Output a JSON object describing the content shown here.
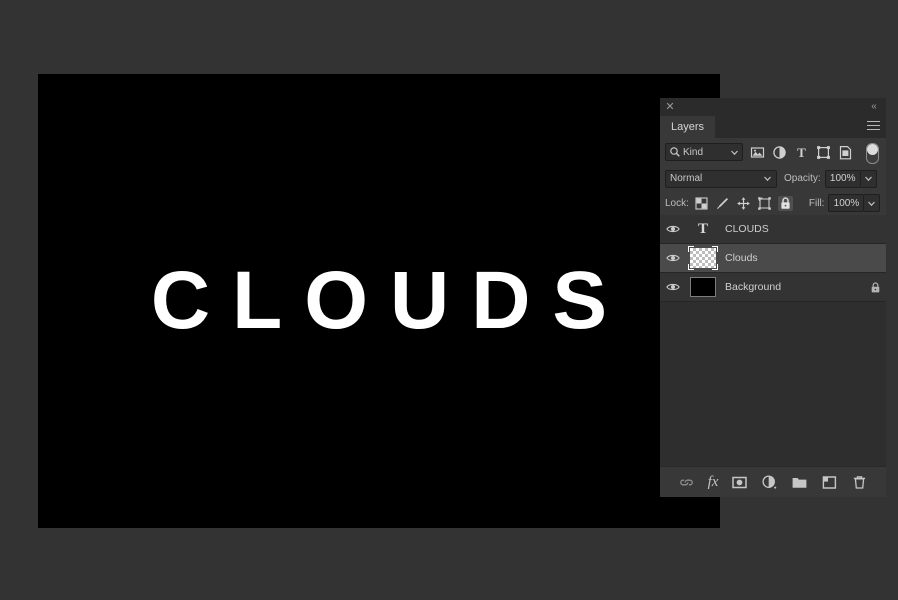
{
  "canvas": {
    "artwork_text": "CLOUDS",
    "background_color": "#000000",
    "text_color": "#ffffff",
    "workspace_color": "#333333"
  },
  "panel": {
    "title_close_icon": "close-icon",
    "collapse_icon": "collapse-double-chevron-icon",
    "tab_label": "Layers",
    "menu_icon": "panel-menu-icon",
    "filter": {
      "search_icon": "search-icon",
      "kind_label": "Kind",
      "caret_icon": "chevron-down-icon",
      "icons": [
        {
          "name": "filter-pixel-icon",
          "title": "Pixel layers"
        },
        {
          "name": "filter-adjustment-icon",
          "title": "Adjustment layers"
        },
        {
          "name": "filter-type-icon",
          "title": "Type layers"
        },
        {
          "name": "filter-shape-icon",
          "title": "Shape layers"
        },
        {
          "name": "filter-smart-object-icon",
          "title": "Smart objects"
        }
      ],
      "toggle_name": "filter-enable-toggle"
    },
    "blend": {
      "mode": "Normal",
      "opacity_label": "Opacity:",
      "opacity_value": "100%"
    },
    "lock": {
      "label": "Lock:",
      "fill_label": "Fill:",
      "fill_value": "100%",
      "icons": [
        {
          "name": "lock-transparency-icon",
          "active": false
        },
        {
          "name": "lock-image-brush-icon",
          "active": false
        },
        {
          "name": "lock-position-move-icon",
          "active": false
        },
        {
          "name": "lock-artboard-nesting-icon",
          "active": false
        },
        {
          "name": "lock-all-padlock-icon",
          "active": true
        }
      ]
    },
    "layers": [
      {
        "name": "CLOUDS",
        "thumb_type": "type",
        "visible": true,
        "selected": false,
        "locked": false
      },
      {
        "name": "Clouds",
        "thumb_type": "transparent",
        "visible": true,
        "selected": true,
        "locked": false
      },
      {
        "name": "Background",
        "thumb_type": "black",
        "visible": true,
        "selected": false,
        "locked": true
      }
    ],
    "bottom_toolbar": [
      {
        "name": "link-layers-icon",
        "label": ""
      },
      {
        "name": "layer-style-fx-icon",
        "label": "fx"
      },
      {
        "name": "add-layer-mask-icon",
        "label": ""
      },
      {
        "name": "new-adjustment-layer-icon",
        "label": ""
      },
      {
        "name": "new-group-folder-icon",
        "label": ""
      },
      {
        "name": "new-layer-icon",
        "label": ""
      },
      {
        "name": "delete-layer-trash-icon",
        "label": ""
      }
    ]
  }
}
